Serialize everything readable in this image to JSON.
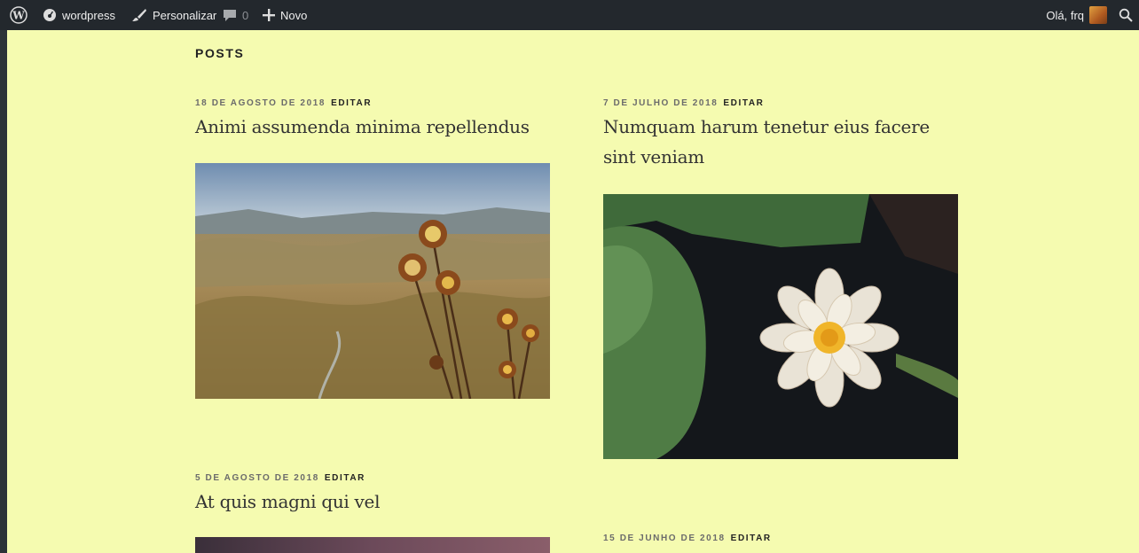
{
  "adminbar": {
    "site_name": "wordpress",
    "customize_label": "Personalizar",
    "comments_count": "0",
    "new_label": "Novo",
    "greeting": "Olá, frq"
  },
  "section_title": "POSTS",
  "posts": [
    {
      "date": "18 DE AGOSTO DE 2018",
      "edit_label": "EDITAR",
      "title": "Animi assumenda minima repellendus",
      "image_icon": "landscape-thistle-photo"
    },
    {
      "date": "7 DE JULHO DE 2018",
      "edit_label": "EDITAR",
      "title_line1": "Numquam harum tenetur eius facere",
      "title_line2": "sint veniam",
      "image_icon": "water-lily-photo"
    },
    {
      "date": "5 DE AGOSTO DE 2018",
      "edit_label": "EDITAR",
      "title": "At quis magni qui vel",
      "image_icon": "dusk-sky-photo"
    },
    {
      "date": "15 DE JUNHO DE 2018",
      "edit_label": "EDITAR"
    }
  ],
  "colors": {
    "page_bg": "#f5fbb0",
    "adminbar_bg": "#23282d"
  }
}
